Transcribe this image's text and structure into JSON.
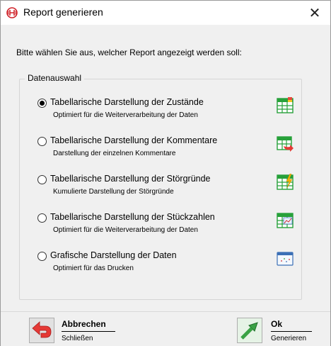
{
  "window": {
    "title": "Report generieren",
    "close_glyph": "✕"
  },
  "prompt": "Bitte wählen Sie aus, welcher Report angezeigt werden soll:",
  "group": {
    "label": "Datenauswahl"
  },
  "options": [
    {
      "title": "Tabellarische Darstellung der Zustände",
      "desc": "Optimiert für die Weiterverarbeitung der Daten",
      "selected": true,
      "icon": "table-status-icon"
    },
    {
      "title": "Tabellarische Darstellung der Kommentare",
      "desc": "Darstellung der einzelnen Kommentare",
      "selected": false,
      "icon": "table-comment-icon"
    },
    {
      "title": "Tabellarische Darstellung der Störgründe",
      "desc": "Kumulierte Darstellung der Störgründe",
      "selected": false,
      "icon": "table-fault-icon"
    },
    {
      "title": "Tabellarische Darstellung der Stückzahlen",
      "desc": "Optimiert für die Weiterverarbeitung der Daten",
      "selected": false,
      "icon": "table-chart-icon"
    },
    {
      "title": "Grafische Darstellung der Daten",
      "desc": "Optimiert für das Drucken",
      "selected": false,
      "icon": "graphic-window-icon"
    }
  ],
  "footer": {
    "cancel": {
      "label": "Abbrechen",
      "sub": "Schließen"
    },
    "ok": {
      "label": "Ok",
      "sub": "Generieren"
    }
  },
  "colors": {
    "accent_red": "#d0232a",
    "table_green": "#27a13a",
    "ok_green": "#3aa245"
  }
}
